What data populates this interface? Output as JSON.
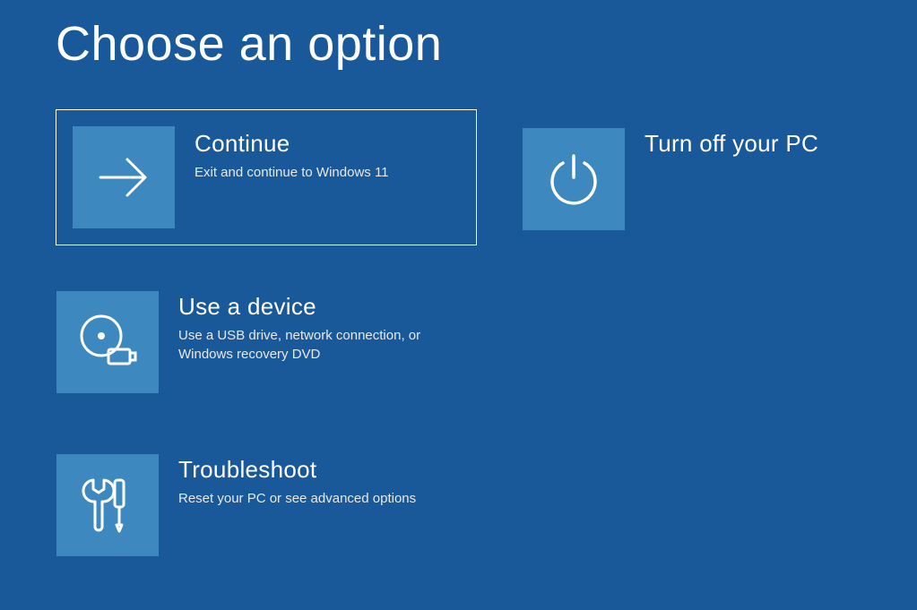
{
  "title": "Choose an option",
  "options": {
    "continue": {
      "title": "Continue",
      "desc": "Exit and continue to Windows 11"
    },
    "turnoff": {
      "title": "Turn off your PC",
      "desc": ""
    },
    "usedevice": {
      "title": "Use a device",
      "desc": "Use a USB drive, network connection, or Windows recovery DVD"
    },
    "troubleshoot": {
      "title": "Troubleshoot",
      "desc": "Reset your PC or see advanced options"
    }
  }
}
